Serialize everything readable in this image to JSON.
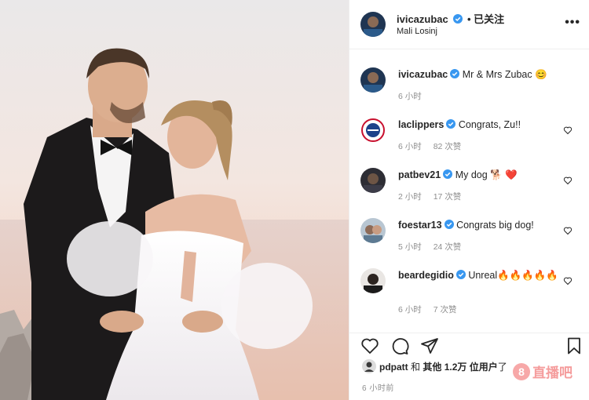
{
  "post": {
    "username": "ivicazubac",
    "follow_status": "• 已关注",
    "location": "Mali Losinj",
    "more_label": "•••",
    "caption": {
      "username": "ivicazubac",
      "text": "Mr & Mrs Zubac 😊",
      "time": "6 小时"
    }
  },
  "comments": [
    {
      "username": "laclippers",
      "text": "Congrats, Zu!!",
      "time": "6 小时",
      "likes": "82 次赞"
    },
    {
      "username": "patbev21",
      "text": "My dog 🐕 ❤️",
      "time": "2 小时",
      "likes": "17 次赞"
    },
    {
      "username": "foestar13",
      "text": "Congrats big dog!",
      "time": "5 小时",
      "likes": "24 次赞"
    },
    {
      "username": "beardegidio",
      "text": "Unreal🔥🔥🔥🔥🔥",
      "time": "6 小时",
      "likes": "7 次赞"
    }
  ],
  "likes": {
    "user": "pdpatt",
    "connector": "和",
    "others": "其他 1.2万 位用户",
    "suffix": "了"
  },
  "post_time": "6 小时前",
  "watermark": {
    "icon": "8",
    "text": "直播吧"
  },
  "colors": {
    "verified": "#3897f0",
    "border": "#efefef",
    "muted": "#8e8e8e",
    "heart_red": "#ed4956"
  },
  "icons": [
    "heart-icon",
    "comment-icon",
    "share-icon",
    "bookmark-icon",
    "verified-badge-icon"
  ]
}
